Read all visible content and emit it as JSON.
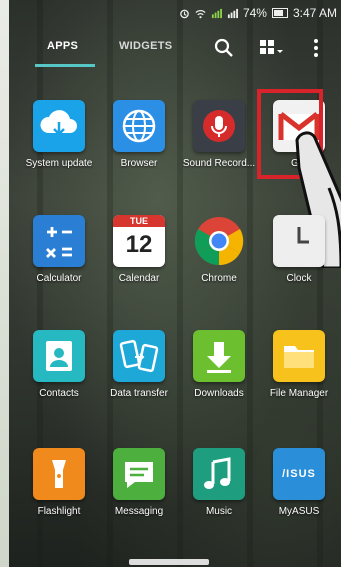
{
  "status": {
    "battery": "74%",
    "time": "3:47 AM"
  },
  "tabs": {
    "apps": "APPS",
    "widgets": "WIDGETS"
  },
  "apps": [
    {
      "label": "System update"
    },
    {
      "label": "Browser"
    },
    {
      "label": "Sound Record..."
    },
    {
      "label": "Gm"
    },
    {
      "label": "Calculator"
    },
    {
      "label": "Calendar",
      "calendar_day": "TUE",
      "calendar_date": "12"
    },
    {
      "label": "Chrome"
    },
    {
      "label": "Clock"
    },
    {
      "label": "Contacts"
    },
    {
      "label": "Data transfer"
    },
    {
      "label": "Downloads"
    },
    {
      "label": "File Manager"
    },
    {
      "label": "Flashlight"
    },
    {
      "label": "Messaging"
    },
    {
      "label": "Music"
    },
    {
      "label": "MyASUS",
      "icon_text": "/ISUS"
    }
  ],
  "colors": {
    "accent_underline": "#56c7c4",
    "highlight": "#d9232b"
  }
}
